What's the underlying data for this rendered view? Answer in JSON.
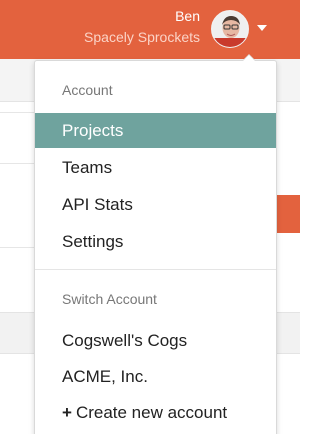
{
  "header": {
    "user_name": "Ben",
    "account_name": "Spacely Sprockets",
    "avatar_icon": "user-avatar",
    "caret_icon": "caret-down-icon",
    "bar_color": "#e3623e"
  },
  "dropdown": {
    "account_header": "Account",
    "account_items": [
      "Projects",
      "Teams",
      "API Stats",
      "Settings"
    ],
    "active_item": "Projects",
    "active_color": "#6fa39e",
    "switch_header": "Switch Account",
    "switch_items": [
      "Cogswell's Cogs",
      "ACME, Inc."
    ],
    "create_label": "Create new account",
    "create_icon": "plus-icon"
  }
}
